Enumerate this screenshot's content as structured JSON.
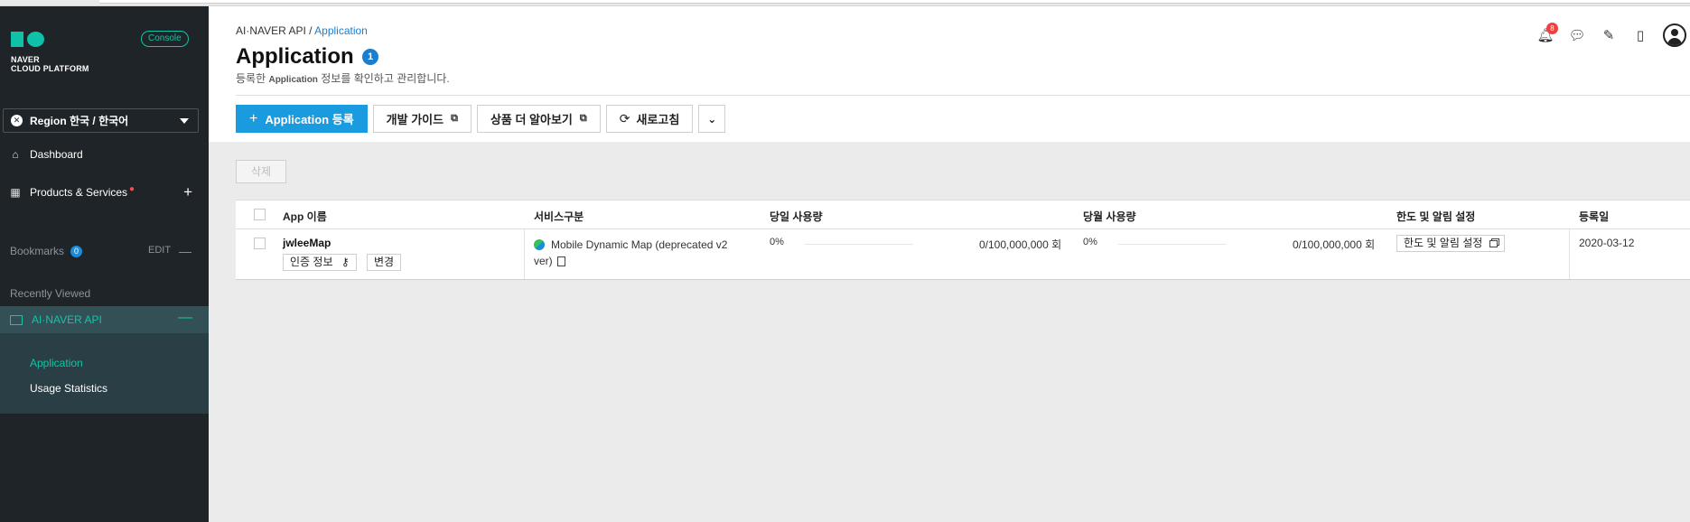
{
  "sidebar": {
    "logo_line1": "NAVER",
    "logo_line2": "CLOUD PLATFORM",
    "console_label": "Console",
    "region_label": "Region 한국 / 한국어",
    "dashboard_label": "Dashboard",
    "products_label": "Products & Services",
    "bookmarks_label": "Bookmarks",
    "bookmarks_count": "0",
    "edit_label": "EDIT",
    "recently_viewed_label": "Recently Viewed",
    "active_section": "AI·NAVER API",
    "sub_items": [
      "Application",
      "Usage Statistics"
    ],
    "accent_color": "#10c5a8"
  },
  "header": {
    "breadcrumb_root": "AI·NAVER API /",
    "breadcrumb_current": "Application",
    "title": "Application",
    "title_count": "1",
    "subtitle_prefix": "등록한",
    "subtitle_bold": "Application",
    "subtitle_suffix": "정보를 확인하고 관리합니다.",
    "notification_count": "8",
    "icons": [
      "bell-icon",
      "chat-icon",
      "memo-icon",
      "book-icon",
      "user-avatar-icon"
    ]
  },
  "toolbar": {
    "register_label": "Application 등록",
    "dev_guide_label": "개발 가이드",
    "more_product_label": "상품 더 알아보기",
    "refresh_label": "새로고침",
    "primary_color": "#1a9be0"
  },
  "content": {
    "delete_label": "삭제",
    "columns": [
      "App 이름",
      "서비스구분",
      "당일 사용량",
      "당월 사용량",
      "한도 및 알림 설정",
      "등록일"
    ],
    "rows": [
      {
        "app_name": "jwleeMap",
        "auth_label": "인증 정보",
        "change_label": "변경",
        "service_line1": "Mobile Dynamic Map (deprecated v2",
        "service_line2": "ver)",
        "daily_percent": "0%",
        "daily_usage": "0/100,000,000 회",
        "monthly_percent": "0%",
        "monthly_usage": "0/100,000,000 회",
        "limit_button": "한도 및 알림 설정",
        "registered": "2020-03-12"
      }
    ]
  }
}
